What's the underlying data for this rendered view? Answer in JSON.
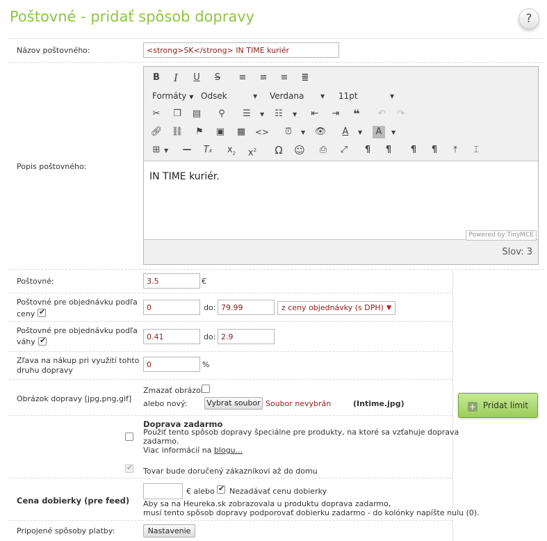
{
  "page": {
    "title": "Poštovné - pridať spôsob dopravy",
    "help_label": "?"
  },
  "name_row": {
    "label": "Názov poštovného:",
    "value": "<strong>SK</strong> IN TIME kuriér"
  },
  "desc_row": {
    "label": "Popis poštovného:"
  },
  "editor": {
    "formats_label": "Formáty",
    "block_label": "Odsek",
    "font_label": "Verdana",
    "size_label": "11pt",
    "content": "IN TIME kuriér.",
    "powered": "Powered by TinyMCE",
    "word_count": "Slov: 3",
    "icons": {
      "row1": [
        "bold-icon",
        "italic-icon",
        "underline-icon",
        "strikethrough-icon",
        "align-left-icon",
        "align-center-icon",
        "align-right-icon",
        "align-justify-icon"
      ],
      "row3": [
        "cut-icon",
        "copy-icon",
        "paste-icon",
        "find-icon",
        "bullet-list-icon",
        "numbered-list-icon",
        "outdent-icon",
        "indent-icon",
        "blockquote-icon",
        "undo-icon",
        "redo-icon"
      ],
      "row4": [
        "link-icon",
        "unlink-icon",
        "anchor-icon",
        "image-icon",
        "media-icon",
        "code-icon",
        "datetime-icon",
        "preview-icon",
        "text-color-icon",
        "background-color-icon"
      ],
      "row5": [
        "table-icon",
        "horizontal-rule-icon",
        "clear-format-icon",
        "subscript-icon",
        "superscript-icon",
        "special-char-icon",
        "emoticon-icon",
        "print-icon",
        "fullscreen-icon",
        "ltr-icon",
        "rtl-icon",
        "visual-chars-icon",
        "visual-blocks-icon",
        "insert-icon",
        "page-break-icon"
      ]
    }
  },
  "postage_row": {
    "label": "Poštovné:",
    "value": "3.5",
    "unit": "€"
  },
  "price_row": {
    "label_line1": "Poštovné pre objednávku podľa",
    "label_line2": "ceny",
    "from": "0",
    "to_label": "do:",
    "to": "79.99",
    "select_value": "z ceny objednávky (s DPH)",
    "checked": true
  },
  "weight_row": {
    "label_line1": "Poštovné pre objednávku podľa",
    "label_line2": "váhy",
    "from": "0.41",
    "to_label": "do:",
    "to": "2.9",
    "checked": true
  },
  "discount_row": {
    "label_line1": "Zľava na nákup pri využití tohto",
    "label_line2": "druhu dopravy",
    "value": "0",
    "unit": "%"
  },
  "image_row": {
    "label": "Obrázok dopravy [jpg,png,gif]",
    "delete_label": "Zmazať obrázok",
    "or_new_label": "alebo nový:",
    "choose_button": "Vybrat soubor",
    "no_file": "Soubor nevybrán",
    "current_file": "(Intime.jpg)"
  },
  "add_limit_button": "Pridat limit",
  "free_shipping": {
    "title": "Doprava zadarmo",
    "desc_line1": "Použiť tento spôsob dopravy špeciálne pre produkty, na ktoré sa vzťahuje doprava",
    "desc_line2": "zadarmo.",
    "more_info": "Viac informácií na",
    "link": "blogu...",
    "delivered_label": "Tovar bude doručený zákazníkovi až do domu"
  },
  "cod_row": {
    "label": "Cena dobierky (pre feed)",
    "value": "",
    "or_label": "€ alebo",
    "no_cod_label": "Nezadávať cenu dobierky",
    "note_line1": "Aby sa na Heureka.sk zobrazovala u produktu doprava zadarmo,",
    "note_line2": "musí tento spôsob dopravy podporovať dobierku zadarmo - do kolónky napíšte nulu (0)."
  },
  "payment_row": {
    "label": "Pripojené spôsoby platby:",
    "button": "Nastavenie"
  }
}
